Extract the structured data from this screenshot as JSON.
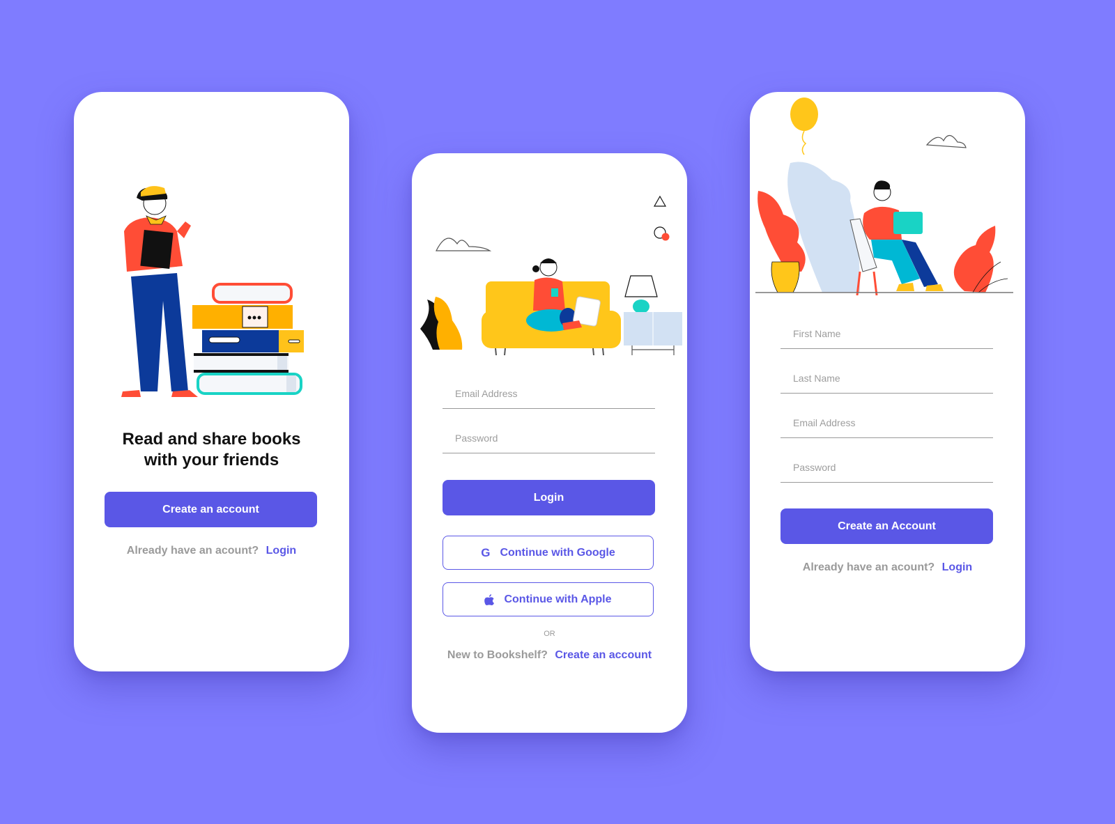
{
  "background_color": "#7f7cff",
  "accent_color": "#5a57e6",
  "welcome": {
    "headline_line1": "Read and share books",
    "headline_line2": "with your friends",
    "create_button": "Create an account",
    "footer_text": "Already have an acount?",
    "footer_link": "Login",
    "illustration": "woman-with-book-stack-illustration"
  },
  "login": {
    "email_placeholder": "Email Address",
    "password_placeholder": "Password",
    "login_button": "Login",
    "google_button": "Continue with Google",
    "google_icon": "google-icon",
    "apple_button": "Continue with Apple",
    "apple_icon": "apple-icon",
    "or_text": "OR",
    "footer_text": "New to Bookshelf?",
    "footer_link": "Create an account",
    "illustration": "woman-on-sofa-illustration"
  },
  "signup": {
    "first_name_placeholder": "First Name",
    "last_name_placeholder": "Last Name",
    "email_placeholder": "Email Address",
    "password_placeholder": "Password",
    "create_button": "Create an Account",
    "footer_text": "Already have an acount?",
    "footer_link": "Login",
    "illustration": "man-with-laptop-illustration"
  }
}
